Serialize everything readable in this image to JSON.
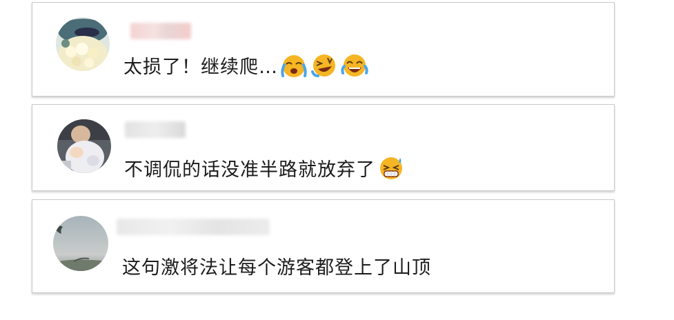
{
  "comments": [
    {
      "username": "",
      "text": "太损了！继续爬…",
      "emojis": [
        "crying-face-icon",
        "rolling-laughing-face-icon",
        "tears-of-joy-face-icon"
      ]
    },
    {
      "username": "",
      "text": "不调侃的话没准半路就放弃了",
      "emojis": [
        "grinning-sweat-face-icon"
      ]
    },
    {
      "username": "",
      "text": "这句激将法让每个游客都登上了山顶",
      "emojis": []
    }
  ],
  "colors": {
    "emoji_yellow": "#f5b524",
    "card_border": "#c9c9c9",
    "text": "#1b1b1b"
  }
}
